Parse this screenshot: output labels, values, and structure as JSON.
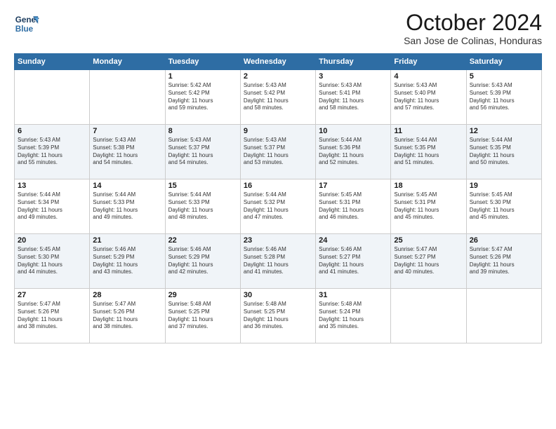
{
  "logo": {
    "line1": "General",
    "line2": "Blue"
  },
  "header": {
    "month": "October 2024",
    "location": "San Jose de Colinas, Honduras"
  },
  "weekdays": [
    "Sunday",
    "Monday",
    "Tuesday",
    "Wednesday",
    "Thursday",
    "Friday",
    "Saturday"
  ],
  "weeks": [
    [
      {
        "day": "",
        "info": ""
      },
      {
        "day": "",
        "info": ""
      },
      {
        "day": "1",
        "info": "Sunrise: 5:42 AM\nSunset: 5:42 PM\nDaylight: 11 hours\nand 59 minutes."
      },
      {
        "day": "2",
        "info": "Sunrise: 5:43 AM\nSunset: 5:42 PM\nDaylight: 11 hours\nand 58 minutes."
      },
      {
        "day": "3",
        "info": "Sunrise: 5:43 AM\nSunset: 5:41 PM\nDaylight: 11 hours\nand 58 minutes."
      },
      {
        "day": "4",
        "info": "Sunrise: 5:43 AM\nSunset: 5:40 PM\nDaylight: 11 hours\nand 57 minutes."
      },
      {
        "day": "5",
        "info": "Sunrise: 5:43 AM\nSunset: 5:39 PM\nDaylight: 11 hours\nand 56 minutes."
      }
    ],
    [
      {
        "day": "6",
        "info": "Sunrise: 5:43 AM\nSunset: 5:39 PM\nDaylight: 11 hours\nand 55 minutes."
      },
      {
        "day": "7",
        "info": "Sunrise: 5:43 AM\nSunset: 5:38 PM\nDaylight: 11 hours\nand 54 minutes."
      },
      {
        "day": "8",
        "info": "Sunrise: 5:43 AM\nSunset: 5:37 PM\nDaylight: 11 hours\nand 54 minutes."
      },
      {
        "day": "9",
        "info": "Sunrise: 5:43 AM\nSunset: 5:37 PM\nDaylight: 11 hours\nand 53 minutes."
      },
      {
        "day": "10",
        "info": "Sunrise: 5:44 AM\nSunset: 5:36 PM\nDaylight: 11 hours\nand 52 minutes."
      },
      {
        "day": "11",
        "info": "Sunrise: 5:44 AM\nSunset: 5:35 PM\nDaylight: 11 hours\nand 51 minutes."
      },
      {
        "day": "12",
        "info": "Sunrise: 5:44 AM\nSunset: 5:35 PM\nDaylight: 11 hours\nand 50 minutes."
      }
    ],
    [
      {
        "day": "13",
        "info": "Sunrise: 5:44 AM\nSunset: 5:34 PM\nDaylight: 11 hours\nand 49 minutes."
      },
      {
        "day": "14",
        "info": "Sunrise: 5:44 AM\nSunset: 5:33 PM\nDaylight: 11 hours\nand 49 minutes."
      },
      {
        "day": "15",
        "info": "Sunrise: 5:44 AM\nSunset: 5:33 PM\nDaylight: 11 hours\nand 48 minutes."
      },
      {
        "day": "16",
        "info": "Sunrise: 5:44 AM\nSunset: 5:32 PM\nDaylight: 11 hours\nand 47 minutes."
      },
      {
        "day": "17",
        "info": "Sunrise: 5:45 AM\nSunset: 5:31 PM\nDaylight: 11 hours\nand 46 minutes."
      },
      {
        "day": "18",
        "info": "Sunrise: 5:45 AM\nSunset: 5:31 PM\nDaylight: 11 hours\nand 45 minutes."
      },
      {
        "day": "19",
        "info": "Sunrise: 5:45 AM\nSunset: 5:30 PM\nDaylight: 11 hours\nand 45 minutes."
      }
    ],
    [
      {
        "day": "20",
        "info": "Sunrise: 5:45 AM\nSunset: 5:30 PM\nDaylight: 11 hours\nand 44 minutes."
      },
      {
        "day": "21",
        "info": "Sunrise: 5:46 AM\nSunset: 5:29 PM\nDaylight: 11 hours\nand 43 minutes."
      },
      {
        "day": "22",
        "info": "Sunrise: 5:46 AM\nSunset: 5:29 PM\nDaylight: 11 hours\nand 42 minutes."
      },
      {
        "day": "23",
        "info": "Sunrise: 5:46 AM\nSunset: 5:28 PM\nDaylight: 11 hours\nand 41 minutes."
      },
      {
        "day": "24",
        "info": "Sunrise: 5:46 AM\nSunset: 5:27 PM\nDaylight: 11 hours\nand 41 minutes."
      },
      {
        "day": "25",
        "info": "Sunrise: 5:47 AM\nSunset: 5:27 PM\nDaylight: 11 hours\nand 40 minutes."
      },
      {
        "day": "26",
        "info": "Sunrise: 5:47 AM\nSunset: 5:26 PM\nDaylight: 11 hours\nand 39 minutes."
      }
    ],
    [
      {
        "day": "27",
        "info": "Sunrise: 5:47 AM\nSunset: 5:26 PM\nDaylight: 11 hours\nand 38 minutes."
      },
      {
        "day": "28",
        "info": "Sunrise: 5:47 AM\nSunset: 5:26 PM\nDaylight: 11 hours\nand 38 minutes."
      },
      {
        "day": "29",
        "info": "Sunrise: 5:48 AM\nSunset: 5:25 PM\nDaylight: 11 hours\nand 37 minutes."
      },
      {
        "day": "30",
        "info": "Sunrise: 5:48 AM\nSunset: 5:25 PM\nDaylight: 11 hours\nand 36 minutes."
      },
      {
        "day": "31",
        "info": "Sunrise: 5:48 AM\nSunset: 5:24 PM\nDaylight: 11 hours\nand 35 minutes."
      },
      {
        "day": "",
        "info": ""
      },
      {
        "day": "",
        "info": ""
      }
    ]
  ]
}
